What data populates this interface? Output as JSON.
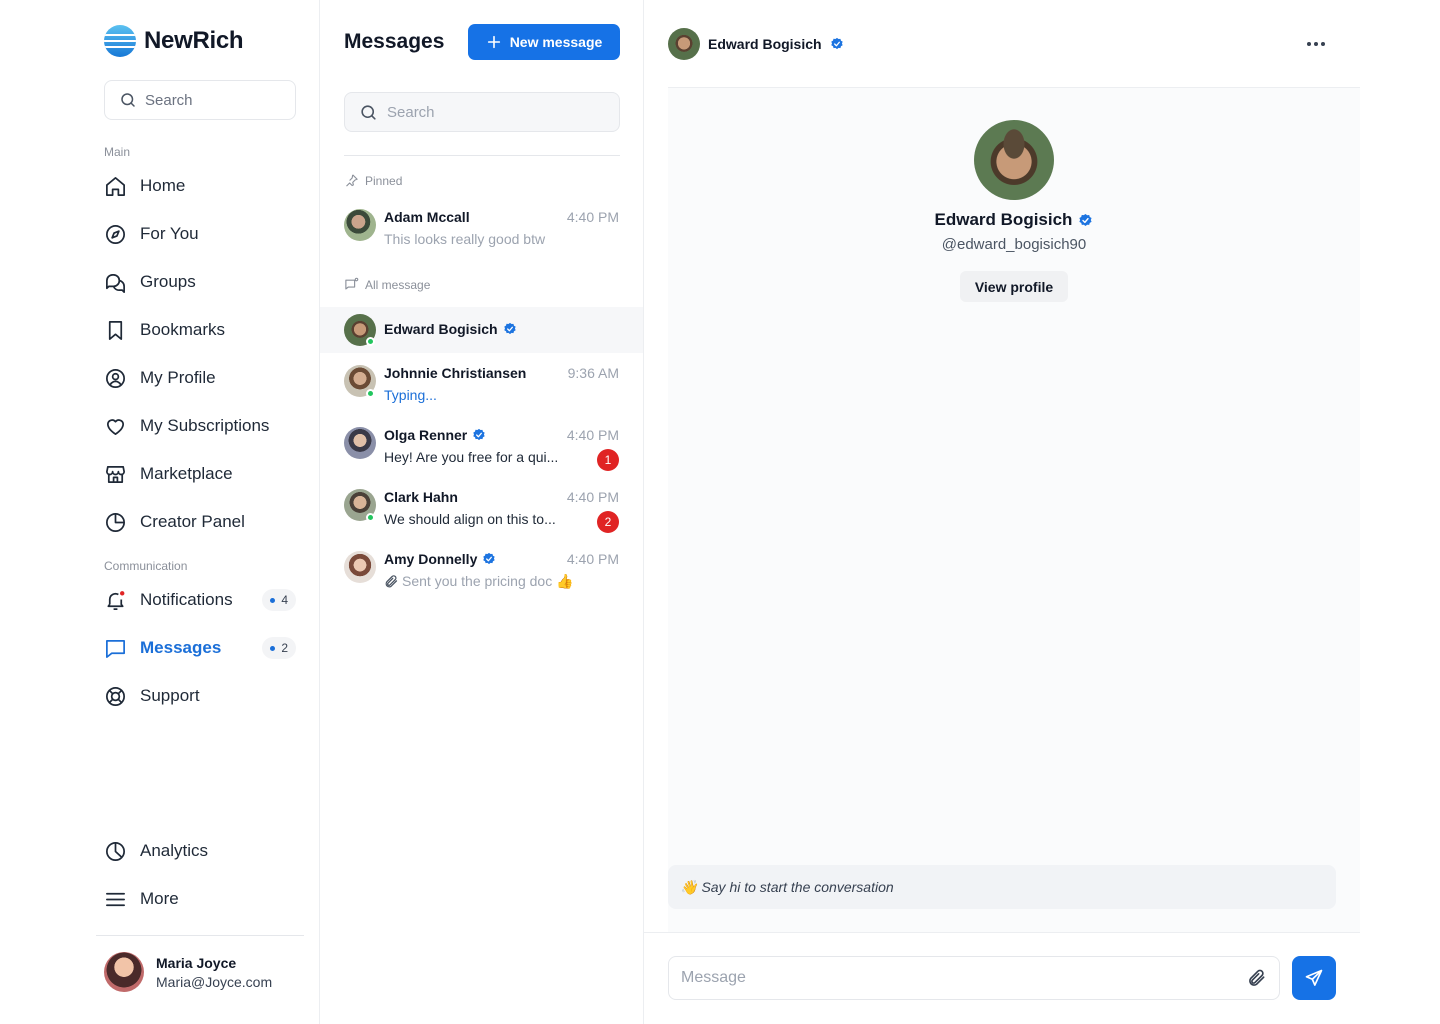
{
  "brand": {
    "name": "NewRich"
  },
  "sidebar": {
    "search_placeholder": "Search",
    "section_main": "Main",
    "section_communication": "Communication",
    "items": [
      {
        "label": "Home",
        "icon": "home-icon"
      },
      {
        "label": "For You",
        "icon": "compass-icon"
      },
      {
        "label": "Groups",
        "icon": "chat-bubbles-icon"
      },
      {
        "label": "Bookmarks",
        "icon": "bookmark-icon"
      },
      {
        "label": "My Profile",
        "icon": "user-circle-icon"
      },
      {
        "label": "My Subscriptions",
        "icon": "heart-icon"
      },
      {
        "label": "Marketplace",
        "icon": "store-icon"
      },
      {
        "label": "Creator Panel",
        "icon": "pie-chart-icon"
      }
    ],
    "comm_items": [
      {
        "label": "Notifications",
        "icon": "bell-icon",
        "badge": "4"
      },
      {
        "label": "Messages",
        "icon": "message-icon",
        "badge": "2",
        "active": true
      },
      {
        "label": "Support",
        "icon": "lifebuoy-icon"
      }
    ],
    "bottom_items": [
      {
        "label": "Analytics",
        "icon": "analytics-icon"
      },
      {
        "label": "More",
        "icon": "menu-icon"
      }
    ],
    "user": {
      "name": "Maria Joyce",
      "email": "Maria@Joyce.com"
    }
  },
  "conversations": {
    "title": "Messages",
    "new_message_label": "New message",
    "search_placeholder": "Search",
    "pinned_label": "Pinned",
    "all_label": "All message",
    "pinned": [
      {
        "name": "Adam Mccall",
        "time": "4:40 PM",
        "preview": "This looks really good btw",
        "verified": false,
        "online": false
      }
    ],
    "all": [
      {
        "name": "Edward Bogisich",
        "time": "",
        "preview": "",
        "verified": true,
        "online": true,
        "selected": true
      },
      {
        "name": "Johnnie Christiansen",
        "time": "9:36 AM",
        "preview": "Typing...",
        "typing": true,
        "verified": false,
        "online": true
      },
      {
        "name": "Olga Renner",
        "time": "4:40 PM",
        "preview": "Hey! Are you free for a qui...",
        "unread": "1",
        "verified": true,
        "online": false
      },
      {
        "name": "Clark Hahn",
        "time": "4:40 PM",
        "preview": "We should align on this to...",
        "unread": "2",
        "verified": false,
        "online": true
      },
      {
        "name": "Amy Donnelly",
        "time": "4:40 PM",
        "preview": "Sent you the pricing doc 👍",
        "attachment": true,
        "verified": true,
        "online": false
      }
    ]
  },
  "chat": {
    "contact_name": "Edward Bogisich",
    "handle": "@edward_bogisich90",
    "view_profile_label": "View profile",
    "hint": "Say hi to start the conversation",
    "hint_emoji": "👋",
    "composer_placeholder": "Message"
  },
  "colors": {
    "accent": "#1672e6",
    "active_nav": "#1b6fd8",
    "unread": "#e02424",
    "online": "#22c55e",
    "verified": "#1d74e0"
  }
}
